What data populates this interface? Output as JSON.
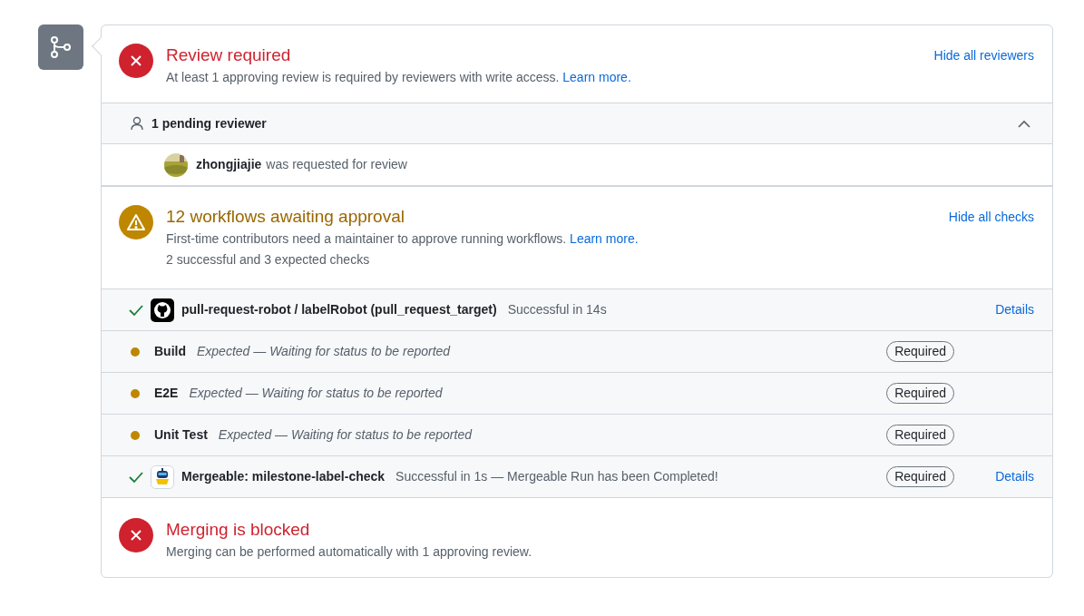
{
  "review": {
    "kind": "error",
    "title": "Review required",
    "description": "At least 1 approving review is required by reviewers with write access.",
    "link": "Learn more.",
    "action": "Hide all reviewers"
  },
  "pending": {
    "label": "1 pending reviewer",
    "expanded": true,
    "reviewers": [
      {
        "user": "zhongjiajie",
        "note": "was requested for review"
      }
    ]
  },
  "workflows": {
    "kind": "warning",
    "title": "12 workflows awaiting approval",
    "description": "First-time contributors need a maintainer to approve running workflows.",
    "link": "Learn more.",
    "summary": "2 successful and 3 expected checks",
    "action": "Hide all checks"
  },
  "checks": [
    {
      "kind": "success",
      "name": "pull-request-robot / labelRobot (pull_request_target)",
      "status": "Successful in 14s",
      "details": "Details"
    },
    {
      "kind": "expected",
      "name": "Build",
      "status": "Expected — Waiting for status to be reported",
      "badge": "Required"
    },
    {
      "kind": "expected",
      "name": "E2E",
      "status": "Expected — Waiting for status to be reported",
      "badge": "Required"
    },
    {
      "kind": "expected",
      "name": "Unit Test",
      "status": "Expected — Waiting for status to be reported",
      "badge": "Required"
    },
    {
      "kind": "success",
      "name": "Mergeable: milestone-label-check",
      "status": "Successful in 1s — Mergeable Run has been Completed!",
      "badge": "Required",
      "details": "Details"
    }
  ],
  "merge": {
    "kind": "error",
    "title": "Merging is blocked",
    "description": "Merging can be performed automatically with 1 approving review."
  }
}
